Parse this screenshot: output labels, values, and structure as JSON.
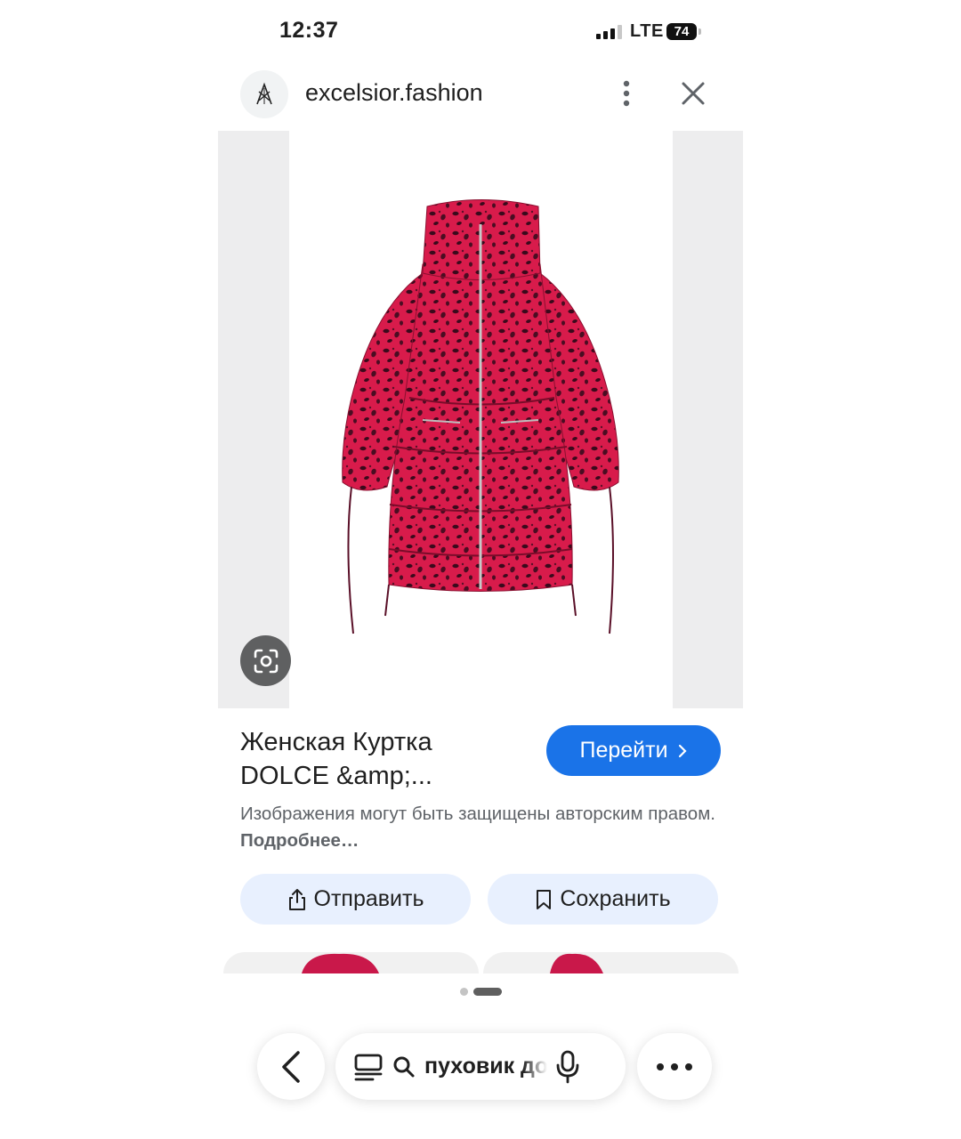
{
  "status_bar": {
    "time": "12:37",
    "network": "LTE",
    "battery": "74"
  },
  "header": {
    "site": "excelsior.fashion"
  },
  "product": {
    "title_line1": "Женская Куртка",
    "title_line2": "DOLCE &amp;...",
    "visit_label": "Перейти",
    "copyright_text": "Изображения могут быть защищены авторским правом.",
    "learn_more": "Подробнее…"
  },
  "actions": {
    "share_label": "Отправить",
    "save_label": "Сохранить"
  },
  "pager": {
    "current": 2,
    "total": 2
  },
  "bottom_bar": {
    "search_query": "пуховик до"
  },
  "colors": {
    "accent": "#1a73e8",
    "pill_bg": "#e8f0fe",
    "jacket": "#d81b4b"
  },
  "icons": [
    "site-logo",
    "more-vert-icon",
    "close-icon",
    "lens-icon",
    "chevron-right-icon",
    "share-icon",
    "bookmark-icon",
    "back-arrow-icon",
    "tabs-icon",
    "search-icon",
    "mic-icon",
    "more-horiz-icon"
  ]
}
